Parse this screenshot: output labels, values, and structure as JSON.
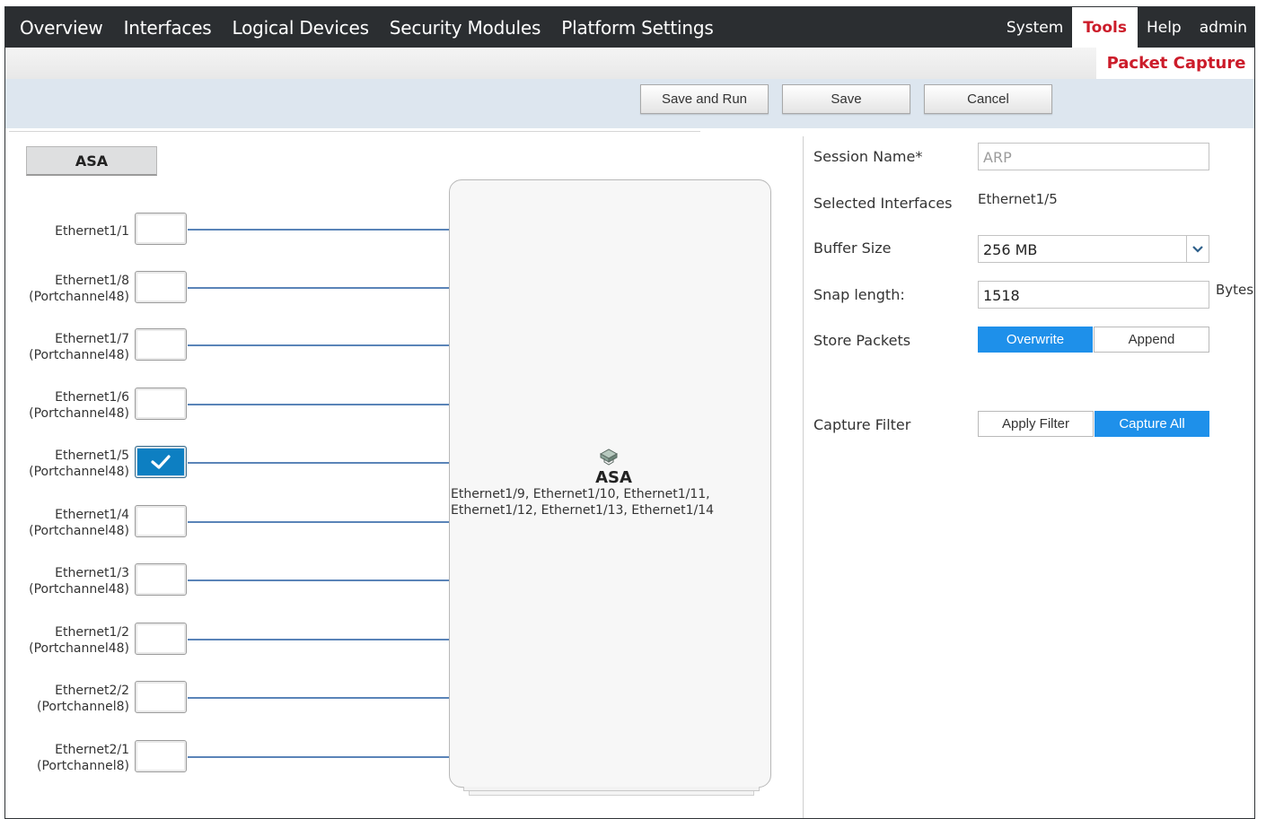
{
  "topnav": {
    "items": [
      "Overview",
      "Interfaces",
      "Logical Devices",
      "Security Modules",
      "Platform Settings"
    ],
    "right": [
      "System",
      "Tools",
      "Help",
      "admin"
    ],
    "active": "Tools"
  },
  "subnav": {
    "active": "Packet Capture"
  },
  "toolbar": {
    "save_run": "Save and Run",
    "save": "Save",
    "cancel": "Cancel"
  },
  "left": {
    "tab": "ASA",
    "interfaces": [
      {
        "line1": "Ethernet1/1",
        "line2": "",
        "checked": false
      },
      {
        "line1": "Ethernet1/8",
        "line2": "(Portchannel48)",
        "checked": false
      },
      {
        "line1": "Ethernet1/7",
        "line2": "(Portchannel48)",
        "checked": false
      },
      {
        "line1": "Ethernet1/6",
        "line2": "(Portchannel48)",
        "checked": false
      },
      {
        "line1": "Ethernet1/5",
        "line2": "(Portchannel48)",
        "checked": true
      },
      {
        "line1": "Ethernet1/4",
        "line2": "(Portchannel48)",
        "checked": false
      },
      {
        "line1": "Ethernet1/3",
        "line2": "(Portchannel48)",
        "checked": false
      },
      {
        "line1": "Ethernet1/2",
        "line2": "(Portchannel48)",
        "checked": false
      },
      {
        "line1": "Ethernet2/2",
        "line2": "(Portchannel8)",
        "checked": false
      },
      {
        "line1": "Ethernet2/1",
        "line2": "(Portchannel8)",
        "checked": false
      }
    ],
    "device": {
      "title": "ASA",
      "ports_line1": "Ethernet1/9, Ethernet1/10, Ethernet1/11,",
      "ports_line2": "Ethernet1/12, Ethernet1/13, Ethernet1/14"
    }
  },
  "form": {
    "session_name_label": "Session Name*",
    "session_name_placeholder": "ARP",
    "selected_interfaces_label": "Selected Interfaces",
    "selected_interfaces_value": "Ethernet1/5",
    "buffer_size_label": "Buffer Size",
    "buffer_size_value": "256 MB",
    "snap_length_label": "Snap length:",
    "snap_length_value": "1518",
    "snap_length_unit": "Bytes",
    "store_packets_label": "Store Packets",
    "store_packets_options": [
      "Overwrite",
      "Append"
    ],
    "store_packets_selected": "Overwrite",
    "capture_filter_label": "Capture Filter",
    "capture_filter_options": [
      "Apply Filter",
      "Capture All"
    ],
    "capture_filter_selected": "Capture All"
  },
  "colors": {
    "nav_bg": "#2b2e31",
    "brand_red": "#cc1c2a",
    "toggle_on": "#1e90ea",
    "checkbox_on": "#0d7fc2",
    "wire": "#5a84b8"
  }
}
